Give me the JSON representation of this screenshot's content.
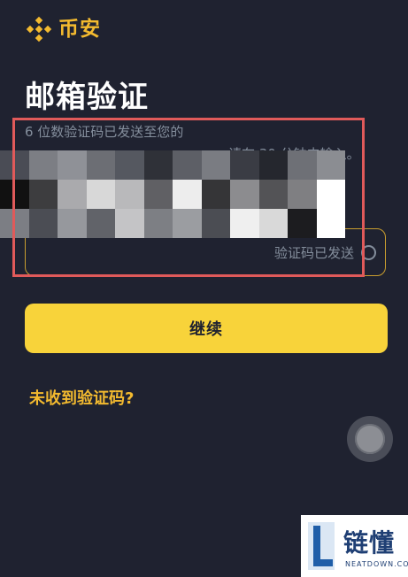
{
  "brand": {
    "name": "币安",
    "logo_icon": "binance-logo-icon",
    "color": "#f3ba2f"
  },
  "title": "邮箱验证",
  "instruction": {
    "line1": "6 位数验证码已发送至您的",
    "line1_tail": "请在 30 分钟内输入。"
  },
  "code_field": {
    "status_text": "验证码已发送",
    "status_icon": "loading-icon"
  },
  "primary_button": {
    "label": "继续",
    "color": "#f8d33a"
  },
  "resend_link": {
    "label": "未收到验证码?"
  },
  "watermark": {
    "title": "链懂",
    "subtitle": "NEATDOWN.COM"
  },
  "colors": {
    "background": "#1f2230",
    "highlight": "#e05a5a",
    "field_border": "#c99e2f"
  }
}
